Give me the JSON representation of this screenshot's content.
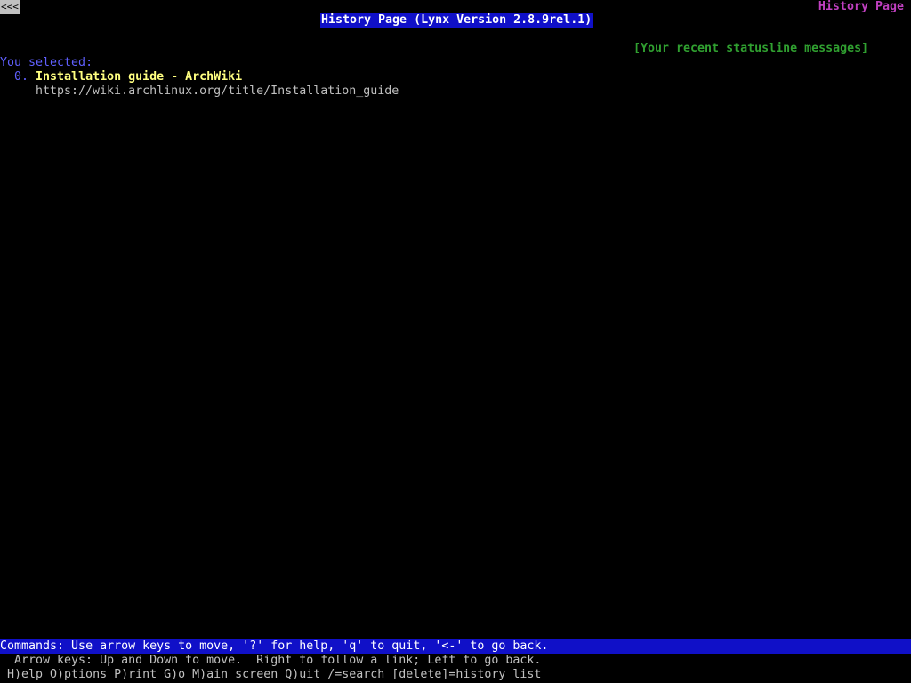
{
  "back_indicator": "<<<",
  "page_label": "History Page",
  "title": "History Page (Lynx Version 2.8.9rel.1)",
  "status_link": "[Your recent statusline messages]",
  "selected_label": "You selected:",
  "history": [
    {
      "number": "0.",
      "title": "Installation guide - ArchWiki",
      "url": "https://wiki.archlinux.org/title/Installation_guide"
    }
  ],
  "footer": {
    "commands": "Commands: Use arrow keys to move, '?' for help, 'q' to quit, '<-' to go back.",
    "arrow_keys": "Arrow keys: Up and Down to move.  Right to follow a link; Left to go back.",
    "shortcuts": "H)elp O)ptions P)rint G)o M)ain screen Q)uit /=search [delete]=history list"
  },
  "colors": {
    "background": "#000000",
    "title_bar": "#1010c8",
    "link": "#ffff80",
    "page_label": "#c040c0",
    "status_link": "#30a030",
    "label": "#6060ff"
  }
}
